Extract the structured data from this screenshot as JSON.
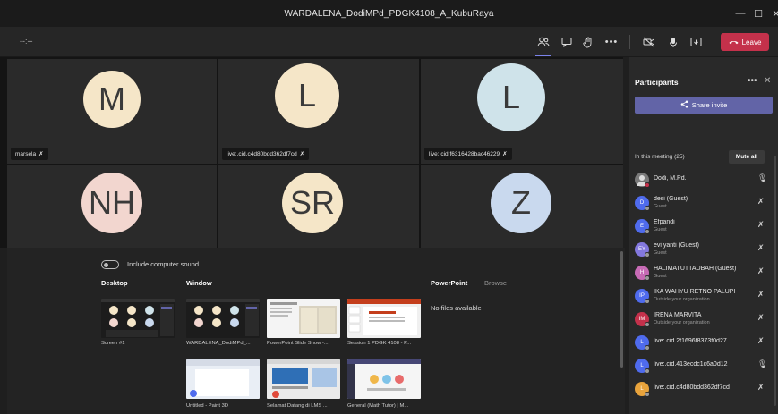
{
  "window": {
    "title": "WARDALENA_DodiMPd_PDGK4108_A_KubuRaya",
    "minimize": "—",
    "maximize": "☐",
    "close": "✕"
  },
  "toolbar": {
    "timer": "--:--",
    "leave_label": "Leave",
    "icons": [
      "participants-icon",
      "chat-icon",
      "raise-hand-icon",
      "more-icon",
      "camera-off-icon",
      "mic-icon",
      "share-tray-icon",
      "phone-icon"
    ]
  },
  "video_tiles": [
    {
      "initials": "M",
      "color": "#f5e6c8",
      "name": "marsela"
    },
    {
      "initials": "L",
      "color": "#f5e6c8",
      "name": "live:.cid.c4d80bdd362df7cd"
    },
    {
      "initials": "L",
      "color": "#cfe3ea",
      "name": "live:.cid.f6316428bac46229"
    },
    {
      "initials": "NH",
      "color": "#f2d6cf",
      "name": ""
    },
    {
      "initials": "SR",
      "color": "#f5e6c8",
      "name": ""
    },
    {
      "initials": "Z",
      "color": "#c9d9ee",
      "name": ""
    }
  ],
  "share_tray": {
    "include_sound": "Include computer sound",
    "desktop_heading": "Desktop",
    "window_heading": "Window",
    "powerpoint_heading": "PowerPoint",
    "browse_label": "Browse",
    "no_files": "No files available",
    "desktop_items": [
      {
        "label": "Screen #1"
      }
    ],
    "window_items": [
      {
        "label": "WARDALENA_DodiMPd_..."
      },
      {
        "label": "PowerPoint Slide Show -..."
      },
      {
        "label": "Session 1 PDGK 4108 - P..."
      },
      {
        "label": "Untitled - Paint 3D"
      },
      {
        "label": "Selamat Datang di LMS ..."
      },
      {
        "label": "General (Math Tutor) | M..."
      }
    ]
  },
  "participants_panel": {
    "title": "Participants",
    "more": "•••",
    "close": "✕",
    "share_invite": "Share invite",
    "in_meeting": "In this meeting (25)",
    "mute_all": "Mute all",
    "people": [
      {
        "initials": "",
        "name": "Dodi, M.Pd.",
        "sub": "",
        "color": "#7a7a7a",
        "mic": "on"
      },
      {
        "initials": "D",
        "name": "desi (Guest)",
        "sub": "Guest",
        "color": "#4f6bed",
        "mic": "off"
      },
      {
        "initials": "E",
        "name": "Efpandi",
        "sub": "Guest",
        "color": "#4f6bed",
        "mic": "off"
      },
      {
        "initials": "EY",
        "name": "evi yanti (Guest)",
        "sub": "Guest",
        "color": "#8378de",
        "mic": "off"
      },
      {
        "initials": "H",
        "name": "HALIMATUTTAUBAH (Guest)",
        "sub": "Guest",
        "color": "#c76bb5",
        "mic": "off"
      },
      {
        "initials": "IP",
        "name": "IKA WAHYU RETNO PALUPI",
        "sub": "Outside your organization",
        "color": "#4f6bed",
        "mic": "off"
      },
      {
        "initials": "IM",
        "name": "IRENA MARVITA",
        "sub": "Outside your organization",
        "color": "#c4314b",
        "mic": "off"
      },
      {
        "initials": "L",
        "name": "live:.cid.2f1696f8373f0d27",
        "sub": "",
        "color": "#4f6bed",
        "mic": "off"
      },
      {
        "initials": "L",
        "name": "live:.cid.413ecdc1c6a0d12",
        "sub": "",
        "color": "#4f6bed",
        "mic": "on"
      },
      {
        "initials": "L",
        "name": "live:.cid.c4d80bdd362df7cd",
        "sub": "",
        "color": "#e8a33c",
        "mic": "off"
      }
    ]
  }
}
